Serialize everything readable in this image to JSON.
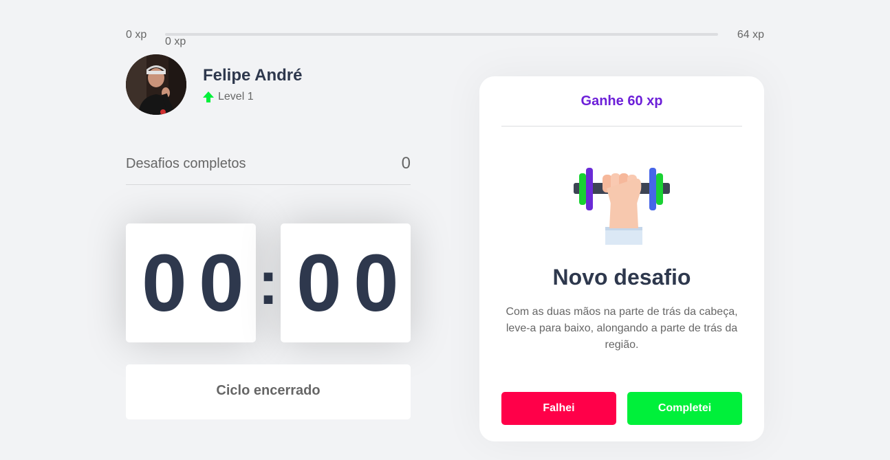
{
  "xp": {
    "min_label": "0 xp",
    "current_label": "0 xp",
    "max_label": "64 xp",
    "progress_percent": 0
  },
  "profile": {
    "name": "Felipe André",
    "level": "Level 1"
  },
  "challenges": {
    "label": "Desafios completos",
    "count": "0"
  },
  "countdown": {
    "minutes": [
      "0",
      "0"
    ],
    "separator": ":",
    "seconds": [
      "0",
      "0"
    ]
  },
  "cycle_button": {
    "label": "Ciclo encerrado"
  },
  "challenge_card": {
    "header": "Ganhe 60 xp",
    "icon": "dumbbell-icon",
    "title": "Novo desafio",
    "description": "Com as duas mãos na parte de trás da cabeça, leve-a para baixo, alongando a parte de trás da região.",
    "fail_label": "Falhei",
    "success_label": "Completei"
  },
  "colors": {
    "background": "#f2f3f5",
    "title": "#2e384d",
    "text": "#666666",
    "accent": "#6c1fd8",
    "fail": "#ff0049",
    "success": "#00f03a",
    "level_arrow": "#00f03a"
  }
}
